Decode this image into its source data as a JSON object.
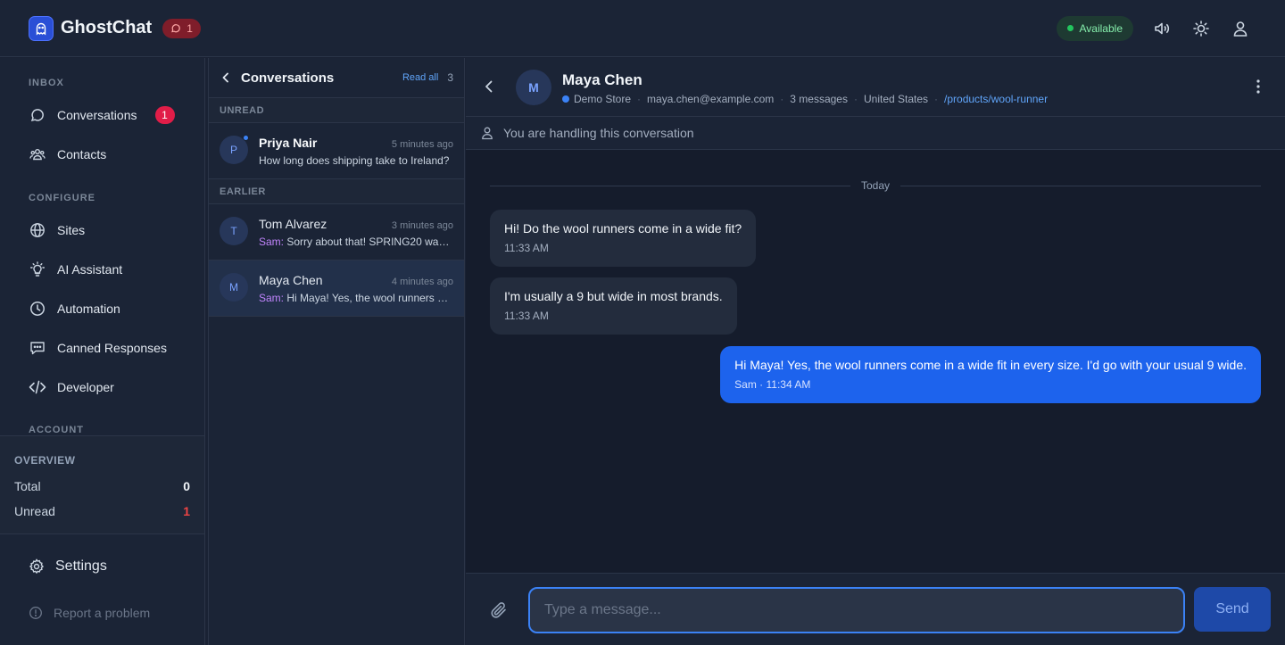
{
  "app": {
    "name": "GhostChat",
    "badge_count": "1"
  },
  "header": {
    "status": "Available"
  },
  "sidebar": {
    "sections": {
      "inbox": "INBOX",
      "configure": "CONFIGURE",
      "account": "ACCOUNT"
    },
    "items": [
      {
        "label": "Conversations",
        "icon": "chat-bubble-icon",
        "badge": "1"
      },
      {
        "label": "Contacts",
        "icon": "users-icon"
      },
      {
        "label": "Sites",
        "icon": "globe-icon"
      },
      {
        "label": "AI Assistant",
        "icon": "lightbulb-icon"
      },
      {
        "label": "Automation",
        "icon": "clock-icon"
      },
      {
        "label": "Canned Responses",
        "icon": "message-square-icon"
      },
      {
        "label": "Developer",
        "icon": "code-icon"
      }
    ],
    "overview": {
      "title": "OVERVIEW",
      "total_label": "Total",
      "total_value": "0",
      "unread_label": "Unread",
      "unread_value": "1"
    },
    "settings_label": "Settings",
    "report_label": "Report a problem"
  },
  "conversation_list": {
    "title": "Conversations",
    "read_all": "Read all",
    "count": "3",
    "groups": {
      "unread": "UNREAD",
      "earlier": "EARLIER"
    },
    "items": [
      {
        "initial": "P",
        "name": "Priya Nair",
        "time": "5 minutes ago",
        "sender": "",
        "preview": "How long does shipping take to Ireland?",
        "unread": true
      },
      {
        "initial": "T",
        "name": "Tom Alvarez",
        "time": "3 minutes ago",
        "sender": "Sam:",
        "preview": "Sorry about that! SPRING20 was…",
        "unread": false
      },
      {
        "initial": "M",
        "name": "Maya Chen",
        "time": "4 minutes ago",
        "sender": "Sam:",
        "preview": "Hi Maya! Yes, the wool runners c…",
        "unread": false
      }
    ]
  },
  "chat": {
    "contact": {
      "initial": "M",
      "name": "Maya Chen",
      "store": "Demo Store",
      "email": "maya.chen@example.com",
      "messages": "3 messages",
      "country": "United States",
      "page": "/products/wool-runner"
    },
    "handling_text": "You are handling this conversation",
    "day_label": "Today",
    "messages": [
      {
        "text": "Hi! Do the wool runners come in a wide fit?",
        "time": "11:33 AM"
      },
      {
        "text": "I'm usually a 9 but wide in most brands.",
        "time": "11:33 AM"
      },
      {
        "text": "Hi Maya! Yes, the wool runners come in a wide fit in every size. I'd go with your usual 9 wide.",
        "sender": "Sam",
        "time": "11:34 AM"
      }
    ],
    "composer": {
      "placeholder": "Type a message...",
      "send_label": "Send"
    }
  },
  "colors": {
    "accent": "#1d63ed",
    "danger": "#e11d48",
    "success": "#22c55e",
    "link": "#60a5fa"
  }
}
